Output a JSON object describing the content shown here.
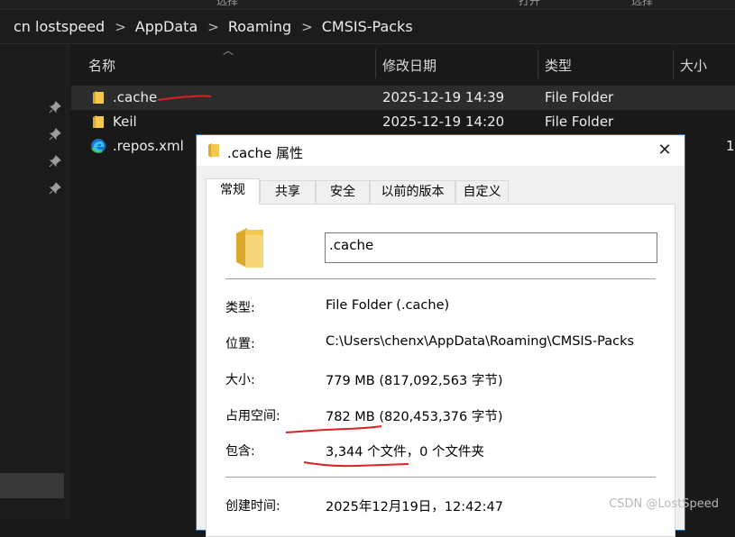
{
  "top_strip": {
    "labels": [
      "选择",
      "打开",
      "选择"
    ]
  },
  "breadcrumb": {
    "items": [
      "cn lostspeed",
      "AppData",
      "Roaming",
      "CMSIS-Packs"
    ],
    "separator": ">"
  },
  "columns": {
    "name": "名称",
    "modified": "修改日期",
    "type": "类型",
    "size": "大小"
  },
  "files": [
    {
      "name": ".cache",
      "modified": "2025-12-19 14:39",
      "type": "File Folder",
      "icon": "folder-icon",
      "selected": true
    },
    {
      "name": "Keil",
      "modified": "2025-12-19 14:20",
      "type": "File Folder",
      "icon": "folder-icon"
    },
    {
      "name": ".repos.xml",
      "icon": "edge-icon",
      "size_partial": "1"
    }
  ],
  "dialog": {
    "title": ".cache 属性",
    "close_glyph": "✕",
    "tabs": [
      "常规",
      "共享",
      "安全",
      "以前的版本",
      "自定义"
    ],
    "active_tab": "常规",
    "name_value": ".cache",
    "props": {
      "type_label": "类型:",
      "type_value": "File Folder (.cache)",
      "location_label": "位置:",
      "location_value": "C:\\Users\\chenx\\AppData\\Roaming\\CMSIS-Packs",
      "size_label": "大小:",
      "size_value": "779 MB (817,092,563 字节)",
      "disk_label": "占用空间:",
      "disk_value": "782 MB (820,453,376 字节)",
      "contains_label": "包含:",
      "contains_value": "3,344 个文件，0 个文件夹",
      "created_label": "创建时间:",
      "created_value": "2025年12月19日，12:42:47"
    }
  },
  "watermark": "CSDN @LostSpeed",
  "colors": {
    "annotation_red": "#e02020",
    "accent_blue": "#0078d7",
    "folder_yellow": "#f2c94c"
  }
}
